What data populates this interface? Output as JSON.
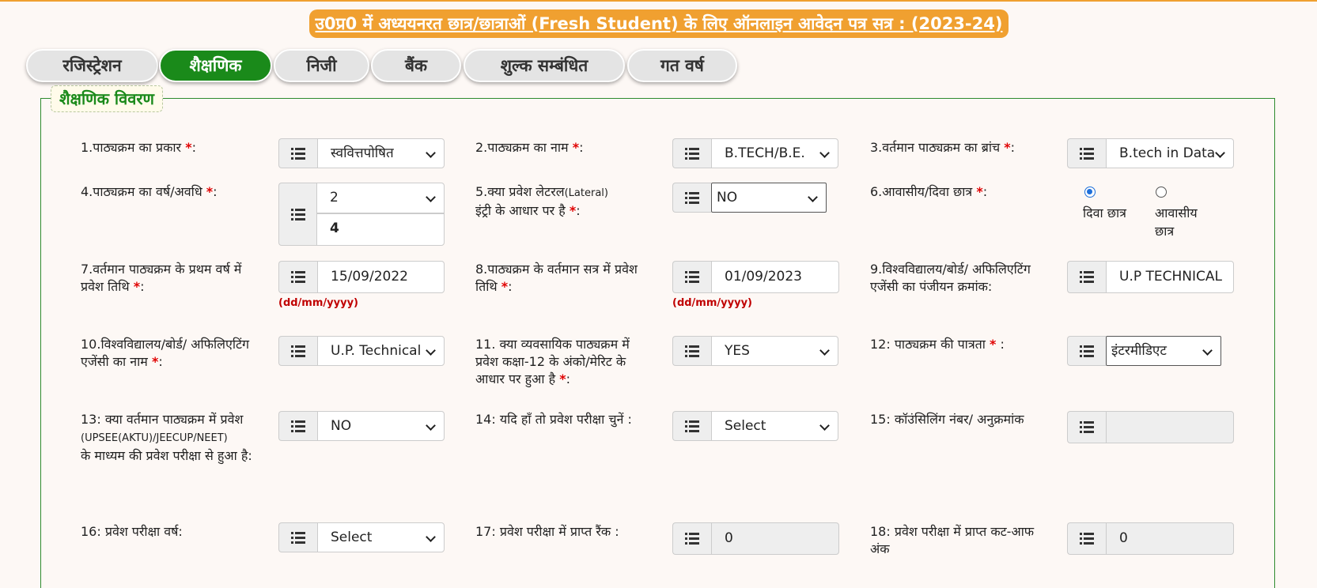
{
  "title": "उ0प्र0 में अध्ययनरत छात्र/छात्राओं (Fresh Student) के लिए ऑनलाइन आवेदन पत्र सत्र : (2023-24)",
  "tabs": [
    "रजिस्ट्रेशन",
    "शैक्षणिक",
    "निजी",
    "बैंक",
    "शुल्क सम्बंधित",
    "गत वर्ष"
  ],
  "active_tab": "शैक्षणिक",
  "section_title": "शैक्षणिक विवरण",
  "date_format_hint": "(dd/mm/yyyy)",
  "fields": {
    "f1": {
      "label": "1.पाठ्यक्रम का प्रकार",
      "value": "स्ववित्तपोषित"
    },
    "f2": {
      "label": "2.पाठ्यक्रम का नाम",
      "value": "B.TECH/B.E."
    },
    "f3": {
      "label": "3.वर्तमान पाठ्यक्रम का ब्रांच",
      "value": "B.tech in Data"
    },
    "f4": {
      "label": "4.पाठ्यक्रम का वर्ष/अवधि",
      "value": "2",
      "value2": "4"
    },
    "f5": {
      "label_l1": "5.क्या प्रवेश लेटरल",
      "label_small": "(Lateral)",
      "label_l2": "इंट्री के आधार पर है",
      "value": "NO"
    },
    "f6": {
      "label": "6.आवासीय/दिवा छात्र",
      "opt1": "दिवा छात्र",
      "opt2": "आवासीय छात्र",
      "selected": "दिवा छात्र"
    },
    "f7": {
      "label": "7.वर्तमान पाठ्यक्रम के प्रथम वर्ष में प्रवेश तिथि",
      "value": "15/09/2022"
    },
    "f8": {
      "label": "8.पाठ्यक्रम के वर्तमान सत्र में प्रवेश तिथि",
      "value": "01/09/2023"
    },
    "f9": {
      "label": "9.विश्वविद्यालय/बोर्ड/ अफिलिएटिंग एजेंसी का पंजीयन क्रमांक:",
      "value": "U.P TECHNICAL"
    },
    "f10": {
      "label": "10.विश्वविद्यालय/बोर्ड/ अफिलिएटिंग एजेंसी का नाम",
      "value": "U.P. Technical"
    },
    "f11": {
      "label": "11. क्या व्यवसायिक पाठ्यक्रम में प्रवेश कक्षा-12 के अंको/मेरिट के आधार पर हुआ है",
      "value": "YES"
    },
    "f12": {
      "label": "12: पाठ्यक्रम की पात्रता",
      "value": "इंटरमीडिएट"
    },
    "f13": {
      "label_l1": "13: क्या वर्तमान पाठ्यक्रम में प्रवेश",
      "label_small": "(UPSEE(AKTU)/JEECUP/NEET)",
      "label_l2": "के माध्यम की प्रवेश परीक्षा से हुआ है:",
      "value": "NO"
    },
    "f14": {
      "label": "14: यदि हाँ तो प्रवेश परीक्षा चुनें :",
      "value": "Select"
    },
    "f15": {
      "label": "15: कॉउंसिलिंग नंबर/ अनुक्रमांक",
      "value": ""
    },
    "f16": {
      "label": "16: प्रवेश परीक्षा वर्ष:",
      "value": "Select"
    },
    "f17": {
      "label": "17: प्रवेश परीक्षा में प्राप्त रैंक :",
      "value": "0"
    },
    "f18": {
      "label": "18: प्रवेश परीक्षा में प्राप्त कट-आफ अंक",
      "value": "0"
    }
  },
  "colors": {
    "accent_orange": "#f0a030",
    "active_green": "#1a8a1a",
    "required_red": "#e00000"
  }
}
